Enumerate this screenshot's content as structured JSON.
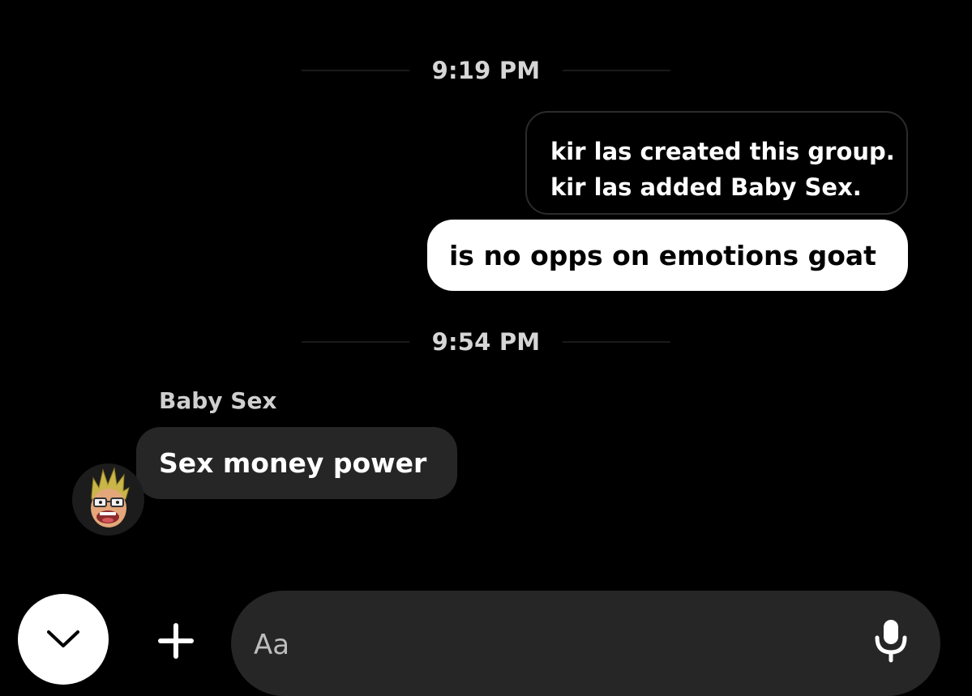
{
  "conversation": {
    "timestamps": [
      "9:19 PM",
      "9:54 PM"
    ],
    "system_messages": [
      "kir las created this group.",
      "kir las added Baby Sex."
    ],
    "outgoing_messages": [
      "is no opps on emotions goat"
    ],
    "incoming": {
      "sender_name": "Baby Sex",
      "messages": [
        "Sex money power"
      ]
    }
  },
  "composer": {
    "placeholder": "Aa"
  },
  "icons": {
    "scroll_down": "chevron-down-icon",
    "add": "plus-icon",
    "microphone": "microphone-icon",
    "avatar": "avatar-image"
  },
  "colors": {
    "background": "#000000",
    "incoming_bubble": "#262626",
    "outgoing_bubble": "#ffffff",
    "timestamp_text": "#d6d6d6"
  }
}
